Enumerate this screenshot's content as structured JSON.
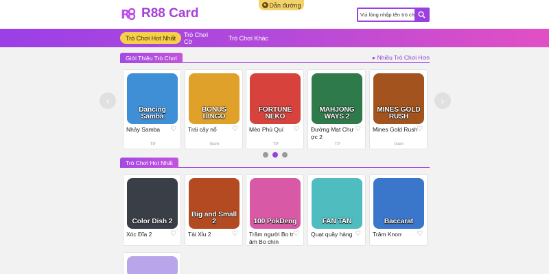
{
  "header": {
    "logo_mark": "R88",
    "logo_text": "R88 Card",
    "guide_label": "Dẫn đường",
    "search_placeholder": "Vui lòng nhập tên trò chơi"
  },
  "nav": {
    "items": [
      {
        "label": "Trò Chơi Hot Nhất",
        "active": true
      },
      {
        "label": "Trò Chơi Cờ",
        "active": false
      },
      {
        "label": "Trò Chơi Khác",
        "active": false
      }
    ]
  },
  "intro": {
    "title": "Giới Thiệu Trò Chơi",
    "more": "▸ Nhiều Trò Chơi Hơn",
    "cards": [
      {
        "name": "Nhảy Samba",
        "provider": "TP",
        "thumb": "Dancing Samba",
        "bg": "#3f8fd6"
      },
      {
        "name": "Trái cây nổ",
        "provider": "Gem",
        "thumb": "BONUS BINGO",
        "bg": "#e0a12a"
      },
      {
        "name": "Mèo Phú Quí",
        "provider": "TP",
        "thumb": "FORTUNE NEKO",
        "bg": "#d7433c"
      },
      {
        "name": "Đường Mạt Chược 2",
        "provider": "TP",
        "thumb": "MAHJONG WAYS 2",
        "bg": "#2f7a4a"
      },
      {
        "name": "Mines Gold Rush",
        "provider": "Gem",
        "thumb": "MINES GOLD RUSH",
        "bg": "#a3541e"
      }
    ]
  },
  "hot": {
    "title": "Trò Chơi Hot Nhất",
    "cards": [
      {
        "name": "Xóc Đĩa 2",
        "thumb": "Color Dish 2",
        "bg": "#3a3f47"
      },
      {
        "name": "Tài Xỉu 2",
        "thumb": "Big and Small 2",
        "bg": "#b44a22"
      },
      {
        "name": "Trăm người Bo trăm Bo chín",
        "thumb": "100 PokDeng",
        "bg": "#d85aa6"
      },
      {
        "name": "Quạt quầy hàng",
        "thumb": "FAN TAN",
        "bg": "#4fbcc0"
      },
      {
        "name": "Trâm Knorr",
        "thumb": "Baccarat",
        "bg": "#3a76c9"
      },
      {
        "name": "",
        "thumb": "",
        "bg": "#b9a6ea"
      }
    ]
  },
  "carousel": {
    "prev": "‹",
    "next": "›"
  },
  "icons": {
    "heart": "♡",
    "search": "search-icon"
  }
}
